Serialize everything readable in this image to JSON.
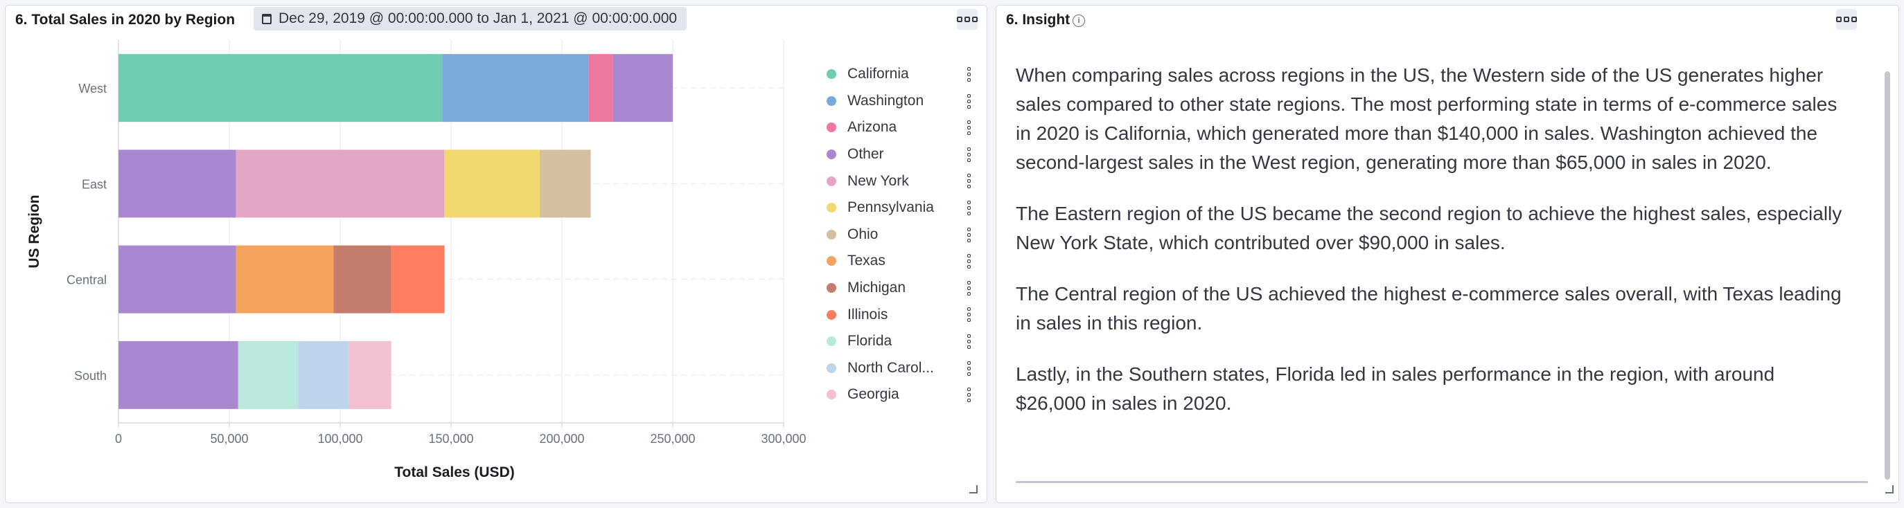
{
  "panel1": {
    "title": "6. Total Sales in 2020 by Region",
    "date_range": "Dec 29, 2019 @ 00:00:00.000 to Jan 1, 2021 @ 00:00:00.000"
  },
  "panel2": {
    "title": "6. Insight",
    "paragraphs": [
      "When comparing sales across regions in the US, the Western side of the US generates higher sales compared to other state regions. The most performing state in terms of e-commerce sales in 2020 is California, which generated more than $140,000 in sales. Washington achieved the second-largest sales in the West region, generating more than $65,000 in sales in 2020.",
      "The Eastern region of the US became the second region to achieve the highest sales, especially New York State, which contributed over $90,000 in sales.",
      "The Central region of the US achieved the highest e-commerce sales overall, with Texas leading in sales in this region.",
      "Lastly, in the Southern states, Florida led in sales performance in the region, with around $26,000 in sales in 2020."
    ]
  },
  "chart_data": {
    "type": "bar",
    "orientation": "horizontal",
    "stacked": true,
    "categories": [
      "West",
      "East",
      "Central",
      "South"
    ],
    "xlabel": "Total Sales (USD)",
    "ylabel": "US Region",
    "xlim": [
      0,
      300000
    ],
    "xticks": [
      0,
      50000,
      100000,
      150000,
      200000,
      250000,
      300000
    ],
    "xtick_labels": [
      "0",
      "50,000",
      "100,000",
      "150,000",
      "200,000",
      "250,000",
      "300,000"
    ],
    "grid": true,
    "legend_position": "right",
    "series": [
      {
        "name": "California",
        "color": "#6dccb1",
        "values": {
          "West": 146000
        }
      },
      {
        "name": "Washington",
        "color": "#79aad9",
        "values": {
          "West": 66000
        }
      },
      {
        "name": "Arizona",
        "color": "#ee789d",
        "values": {
          "West": 11000
        }
      },
      {
        "name": "Other",
        "color": "#a987d1",
        "values": {
          "West": 27000,
          "East": 53000,
          "Central": 53000,
          "South": 54000
        }
      },
      {
        "name": "New York",
        "color": "#e4a6c7",
        "values": {
          "East": 94000
        }
      },
      {
        "name": "Pennsylvania",
        "color": "#f1d86f",
        "values": {
          "East": 43000
        }
      },
      {
        "name": "Ohio",
        "color": "#d2c0a0",
        "values": {
          "East": 23000
        }
      },
      {
        "name": "Texas",
        "color": "#f5a35c",
        "values": {
          "Central": 44000
        }
      },
      {
        "name": "Michigan",
        "color": "#c47c6c",
        "values": {
          "Central": 26000
        }
      },
      {
        "name": "Illinois",
        "color": "#ff7e62",
        "values": {
          "Central": 24000
        }
      },
      {
        "name": "Florida",
        "color": "#b9e9dc",
        "values": {
          "South": 27000
        }
      },
      {
        "name": "North Carolina",
        "color": "#bcd4ec",
        "values": {
          "South": 23000
        }
      },
      {
        "name": "Georgia",
        "color": "#f2c0d1",
        "values": {
          "South": 19000
        }
      }
    ]
  },
  "legend_items": [
    "California",
    "Washington",
    "Arizona",
    "Other",
    "New York",
    "Pennsylvania",
    "Ohio",
    "Texas",
    "Michigan",
    "Illinois",
    "Florida",
    "North Carol...",
    "Georgia"
  ]
}
